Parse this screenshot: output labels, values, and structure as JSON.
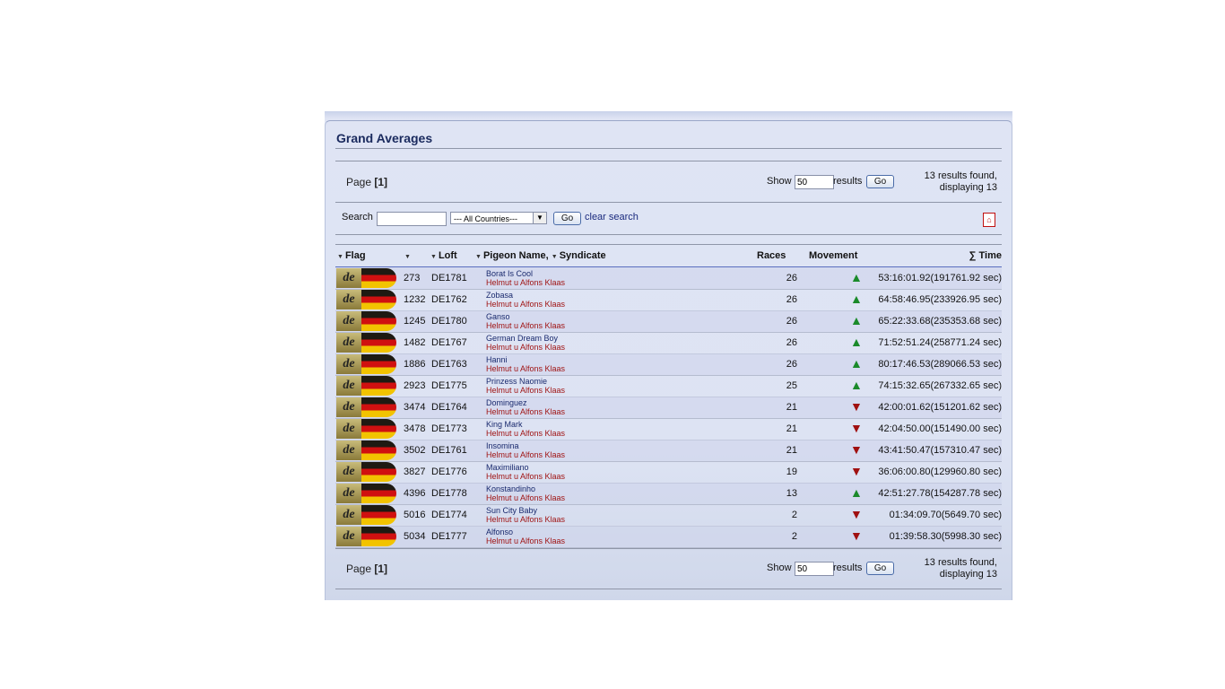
{
  "title": "Grand Averages",
  "pager": {
    "page_label": "Page",
    "page_current": "[1]",
    "show_label": "Show",
    "show_value": "50",
    "results_label": "results",
    "go_label": "Go",
    "found_line1": "13 results found,",
    "found_line2": "displaying 13"
  },
  "search": {
    "label": "Search",
    "value": "",
    "country_selected": "--- All Countries---",
    "go_label": "Go",
    "clear_label": "clear search"
  },
  "columns": {
    "flag": "Flag",
    "loft": "Loft",
    "pigeon_name": "Pigeon Name,",
    "syndicate": "Syndicate",
    "races": "Races",
    "movement": "Movement",
    "time": "∑ Time"
  },
  "rows": [
    {
      "country": "de",
      "rank": "273",
      "loft": "DE1781",
      "name": "Borat Is Cool",
      "syndicate": "Helmut u Alfons Klaas",
      "races": "26",
      "movement": "up",
      "time": "53:16:01.92(191761.92 sec)"
    },
    {
      "country": "de",
      "rank": "1232",
      "loft": "DE1762",
      "name": "Zobasa",
      "syndicate": "Helmut u Alfons Klaas",
      "races": "26",
      "movement": "up",
      "time": "64:58:46.95(233926.95 sec)"
    },
    {
      "country": "de",
      "rank": "1245",
      "loft": "DE1780",
      "name": "Ganso",
      "syndicate": "Helmut u Alfons Klaas",
      "races": "26",
      "movement": "up",
      "time": "65:22:33.68(235353.68 sec)"
    },
    {
      "country": "de",
      "rank": "1482",
      "loft": "DE1767",
      "name": "German Dream Boy",
      "syndicate": "Helmut u Alfons Klaas",
      "races": "26",
      "movement": "up",
      "time": "71:52:51.24(258771.24 sec)"
    },
    {
      "country": "de",
      "rank": "1886",
      "loft": "DE1763",
      "name": "Hanni",
      "syndicate": "Helmut u Alfons Klaas",
      "races": "26",
      "movement": "up",
      "time": "80:17:46.53(289066.53 sec)"
    },
    {
      "country": "de",
      "rank": "2923",
      "loft": "DE1775",
      "name": "Prinzess Naomie",
      "syndicate": "Helmut u Alfons Klaas",
      "races": "25",
      "movement": "up",
      "time": "74:15:32.65(267332.65 sec)"
    },
    {
      "country": "de",
      "rank": "3474",
      "loft": "DE1764",
      "name": "Dominguez",
      "syndicate": "Helmut u Alfons Klaas",
      "races": "21",
      "movement": "down",
      "time": "42:00:01.62(151201.62 sec)"
    },
    {
      "country": "de",
      "rank": "3478",
      "loft": "DE1773",
      "name": "King Mark",
      "syndicate": "Helmut u Alfons Klaas",
      "races": "21",
      "movement": "down",
      "time": "42:04:50.00(151490.00 sec)"
    },
    {
      "country": "de",
      "rank": "3502",
      "loft": "DE1761",
      "name": "Insomina",
      "syndicate": "Helmut u Alfons Klaas",
      "races": "21",
      "movement": "down",
      "time": "43:41:50.47(157310.47 sec)"
    },
    {
      "country": "de",
      "rank": "3827",
      "loft": "DE1776",
      "name": "Maximiliano",
      "syndicate": "Helmut u Alfons Klaas",
      "races": "19",
      "movement": "down",
      "time": "36:06:00.80(129960.80 sec)"
    },
    {
      "country": "de",
      "rank": "4396",
      "loft": "DE1778",
      "name": "Konstandinho",
      "syndicate": "Helmut u Alfons Klaas",
      "races": "13",
      "movement": "up",
      "time": "42:51:27.78(154287.78 sec)"
    },
    {
      "country": "de",
      "rank": "5016",
      "loft": "DE1774",
      "name": "Sun City Baby",
      "syndicate": "Helmut u Alfons Klaas",
      "races": "2",
      "movement": "down",
      "time": "01:34:09.70(5649.70 sec)"
    },
    {
      "country": "de",
      "rank": "5034",
      "loft": "DE1777",
      "name": "Alfonso",
      "syndicate": "Helmut u Alfons Klaas",
      "races": "2",
      "movement": "down",
      "time": "01:39:58.30(5998.30 sec)"
    }
  ]
}
